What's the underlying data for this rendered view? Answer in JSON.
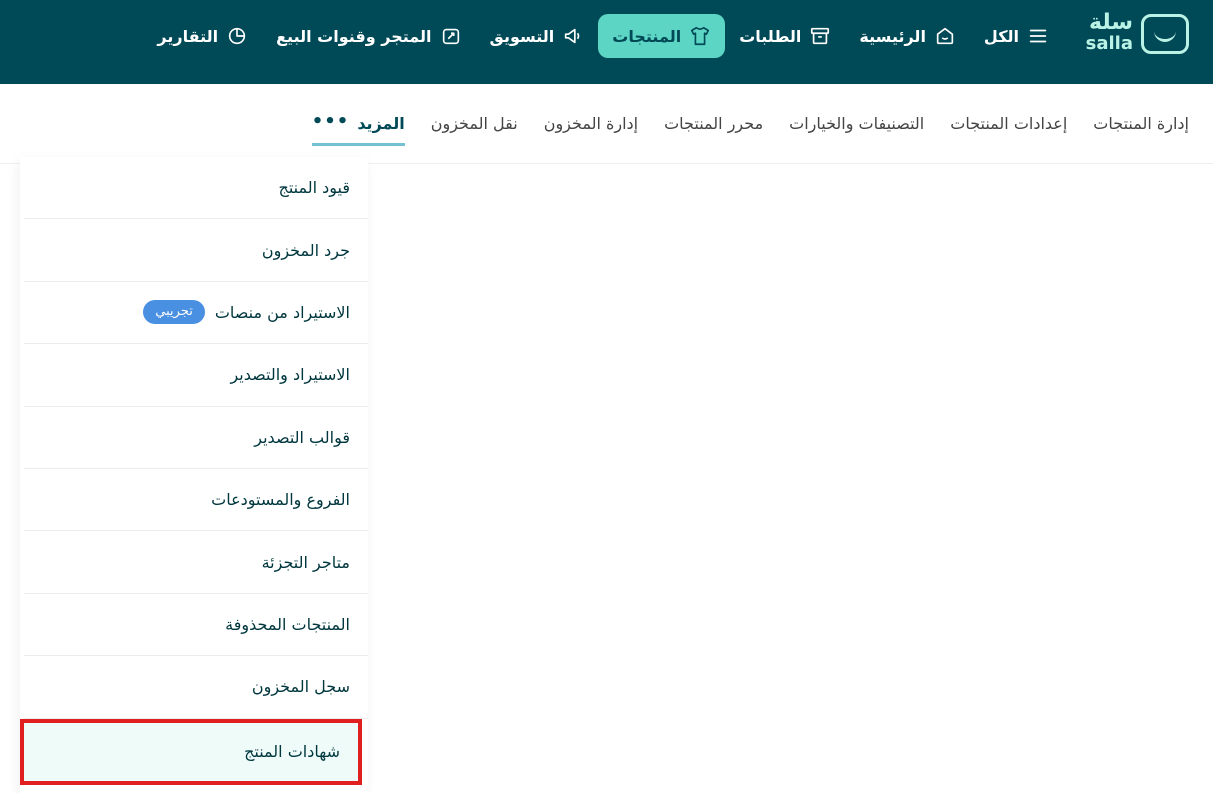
{
  "brand": {
    "logo_ar": "سلة",
    "logo_en": "salla"
  },
  "nav": {
    "items": [
      {
        "label": "الكل",
        "icon": "menu-icon"
      },
      {
        "label": "الرئيسية",
        "icon": "home-icon"
      },
      {
        "label": "الطلبات",
        "icon": "box-icon"
      },
      {
        "label": "المنتجات",
        "icon": "shirt-icon",
        "active": true
      },
      {
        "label": "التسويق",
        "icon": "megaphone-icon"
      },
      {
        "label": "المتجر وقنوات البيع",
        "icon": "store-channels-icon"
      },
      {
        "label": "التقارير",
        "icon": "pie-chart-icon"
      }
    ]
  },
  "subtabs": {
    "items": [
      "إدارة المنتجات",
      "إعدادات المنتجات",
      "التصنيفات والخيارات",
      "محرر المنتجات",
      "إدارة المخزون",
      "نقل المخزون"
    ],
    "more_label": "المزيد"
  },
  "dropdown": {
    "items": [
      {
        "label": "قيود المنتج"
      },
      {
        "label": "جرد المخزون"
      },
      {
        "label": "الاستيراد من منصات",
        "badge": "تجريبي"
      },
      {
        "label": "الاستيراد والتصدير"
      },
      {
        "label": "قوالب التصدير"
      },
      {
        "label": "الفروع والمستودعات"
      },
      {
        "label": "متاجر التجزئة"
      },
      {
        "label": "المنتجات المحذوفة"
      },
      {
        "label": "سجل المخزون"
      },
      {
        "label": "شهادات المنتج",
        "highlighted": true
      }
    ]
  },
  "colors": {
    "topbar": "#004956",
    "active_nav": "#5dd5c4",
    "brand_mint": "#baf3e6",
    "badge": "#4a90e2",
    "highlight_border": "#e02020",
    "highlight_bg": "#eefbf9"
  }
}
